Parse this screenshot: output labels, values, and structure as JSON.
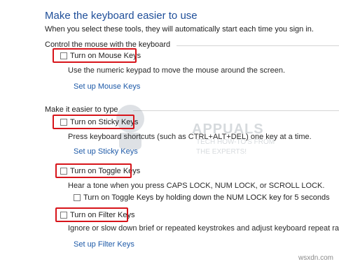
{
  "header": {
    "title": "Make the keyboard easier to use",
    "subtitle": "When you select these tools, they will automatically start each time you sign in."
  },
  "mouse_section": {
    "heading": "Control the mouse with the keyboard",
    "mouse_keys": {
      "label": "Turn on Mouse Keys",
      "checked": false,
      "description": "Use the numeric keypad to move the mouse around the screen.",
      "setup_link": "Set up Mouse Keys"
    }
  },
  "typing_section": {
    "heading": "Make it easier to type",
    "sticky_keys": {
      "label": "Turn on Sticky Keys",
      "checked": false,
      "description": "Press keyboard shortcuts (such as CTRL+ALT+DEL) one key at a time.",
      "setup_link": "Set up Sticky Keys"
    },
    "toggle_keys": {
      "label": "Turn on Toggle Keys",
      "checked": false,
      "description": "Hear a tone when you press CAPS LOCK, NUM LOCK, or SCROLL LOCK.",
      "sub_option": {
        "label": "Turn on Toggle Keys by holding down the NUM LOCK key for 5 seconds",
        "checked": false
      }
    },
    "filter_keys": {
      "label": "Turn on Filter Keys",
      "checked": false,
      "description": "Ignore or slow down brief or repeated keystrokes and adjust keyboard repeat rates.",
      "setup_link": "Set up Filter Keys"
    }
  },
  "watermark": {
    "brand": "APPUALS",
    "tagline_1": "TECH HOW-TO'S FROM",
    "tagline_2": "THE EXPERTS!"
  },
  "footer": {
    "site": "wsxdn.com"
  },
  "colors": {
    "title_blue": "#1e4e99",
    "link_blue": "#1e5aa8",
    "highlight_red": "#d7141a"
  }
}
